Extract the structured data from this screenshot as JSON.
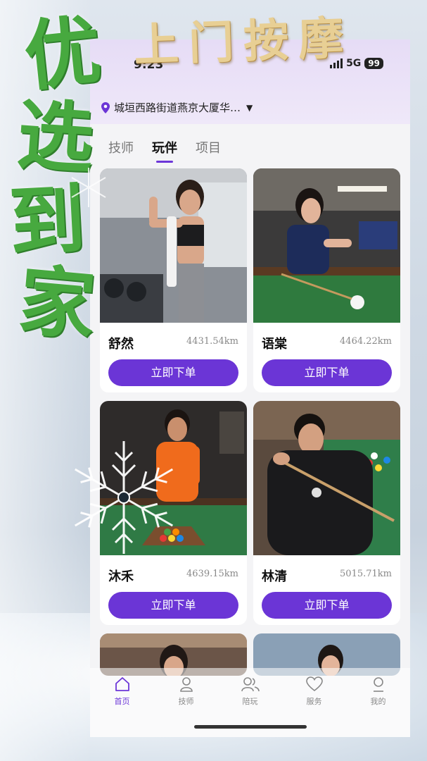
{
  "overlay": {
    "title": "上门按摩",
    "vertical_chars": [
      "优",
      "选",
      "到",
      "家"
    ]
  },
  "status_bar": {
    "time": "9:23",
    "network": "5G",
    "battery": "99"
  },
  "header": {
    "location": "城垣西路街道燕京大厦华…"
  },
  "tabs": [
    {
      "label": "技师",
      "active": false
    },
    {
      "label": "玩伴",
      "active": true
    },
    {
      "label": "项目",
      "active": false
    }
  ],
  "cards": [
    {
      "name": "舒然",
      "distance": "4431.54km",
      "button": "立即下单"
    },
    {
      "name": "语棠",
      "distance": "4464.22km",
      "button": "立即下单"
    },
    {
      "name": "沐禾",
      "distance": "4639.15km",
      "button": "立即下单"
    },
    {
      "name": "林清",
      "distance": "5015.71km",
      "button": "立即下单"
    }
  ],
  "bottom_nav": [
    {
      "label": "首页",
      "icon": "home-icon",
      "active": true
    },
    {
      "label": "技师",
      "icon": "technician-icon",
      "active": false
    },
    {
      "label": "陪玩",
      "icon": "companion-icon",
      "active": false
    },
    {
      "label": "服务",
      "icon": "heart-icon",
      "active": false
    },
    {
      "label": "我的",
      "icon": "profile-icon",
      "active": false
    }
  ],
  "colors": {
    "accent": "#6b35d6",
    "header_bg": "#e6dcf6",
    "title_gold": "#e8cf94",
    "calligraphy_green": "#47a93f"
  }
}
